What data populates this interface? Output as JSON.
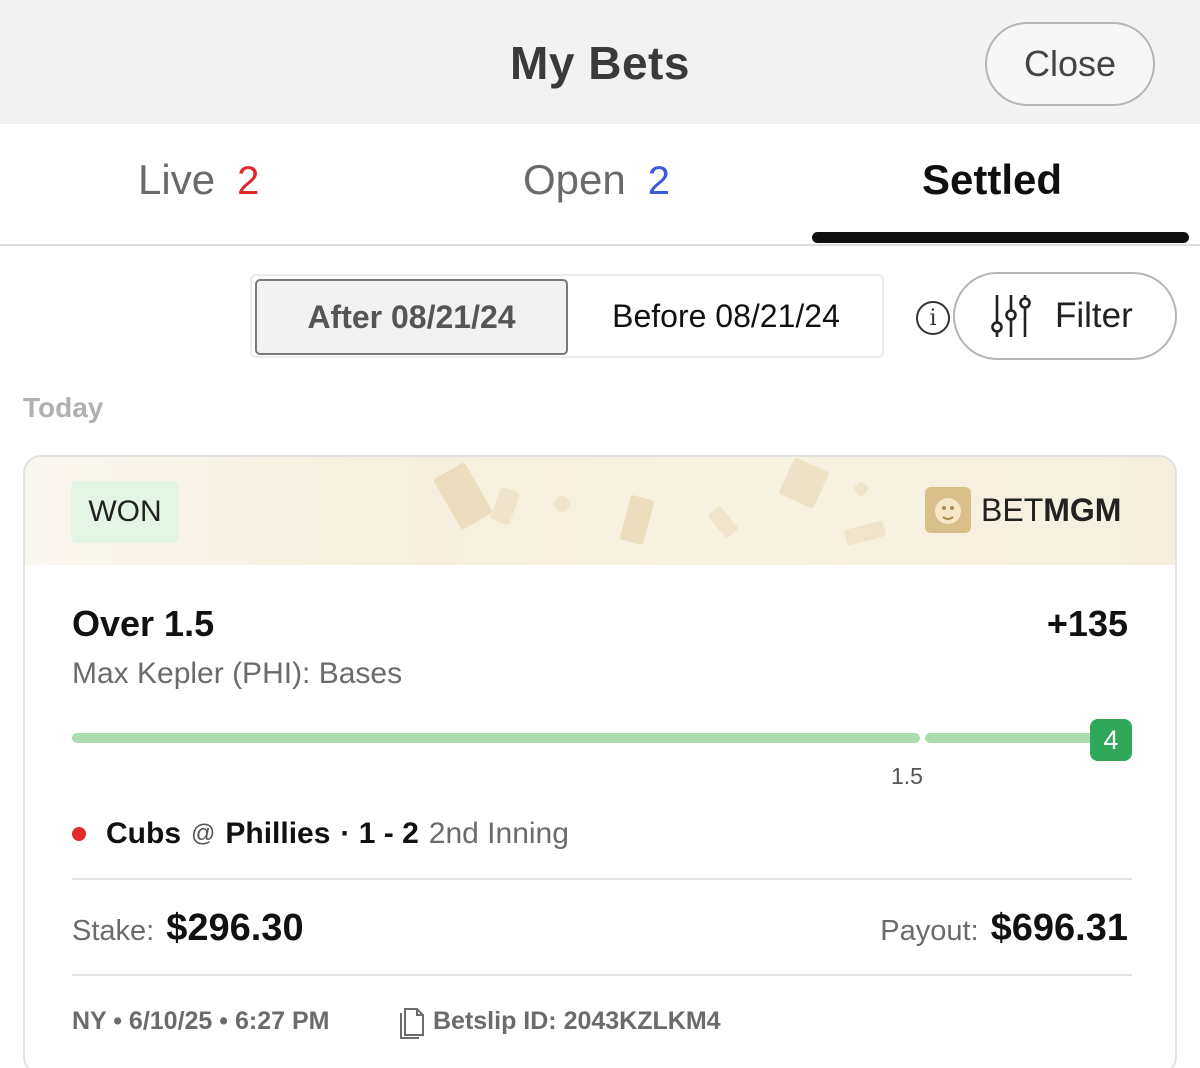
{
  "header": {
    "title": "My Bets",
    "close_label": "Close"
  },
  "tabs": [
    {
      "label": "Live",
      "count": "2"
    },
    {
      "label": "Open",
      "count": "2"
    },
    {
      "label": "Settled",
      "count": ""
    }
  ],
  "active_tab": "Settled",
  "date_filter": {
    "after_label": "After 08/21/24",
    "before_label": "Before 08/21/24",
    "selected": "After 08/21/24"
  },
  "filter": {
    "label": "Filter"
  },
  "section": {
    "label": "Today"
  },
  "bet": {
    "status": "WON",
    "brand": {
      "prefix": "BET",
      "suffix": "MGM"
    },
    "selection": "Over 1.5",
    "odds": "+135",
    "market": "Max Kepler (PHI): Bases",
    "progress": {
      "current": "4",
      "threshold": "1.5"
    },
    "game": {
      "away": "Cubs",
      "separator": "@",
      "home": "Phillies",
      "score": "· 1 - 2",
      "period": "2nd Inning"
    },
    "stake": {
      "label": "Stake:",
      "value": "$296.30"
    },
    "payout": {
      "label": "Payout:",
      "value": "$696.31"
    },
    "meta": "NY • 6/10/25 • 6:27 PM",
    "betslip": "Betslip ID: 2043KZLKM4"
  },
  "colors": {
    "won_green": "#2fa85a",
    "progress_green": "#abdcb0",
    "live_red": "#e3262a",
    "open_blue": "#3b5bdb"
  }
}
